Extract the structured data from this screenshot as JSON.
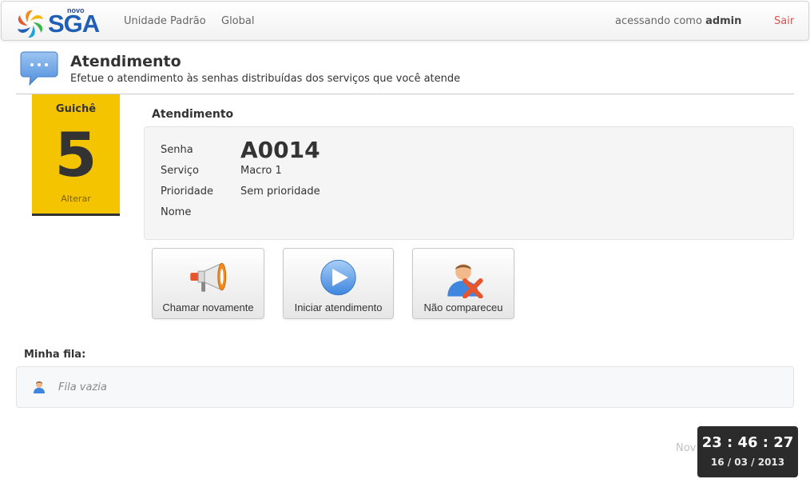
{
  "navbar": {
    "logo_small": "novo",
    "logo_text": "SGA",
    "links": [
      {
        "label": "Unidade Padrão"
      },
      {
        "label": "Global"
      }
    ],
    "user_prefix": "acessando como",
    "user_name": "admin",
    "logout_label": "Sair"
  },
  "header": {
    "title": "Atendimento",
    "subtitle": "Efetue o atendimento às senhas distribuídas dos serviços que você atende"
  },
  "guiche": {
    "label": "Guichê",
    "number": "5",
    "change_label": "Alterar"
  },
  "atendimento": {
    "title": "Atendimento",
    "fields": {
      "senha_label": "Senha",
      "senha_value": "A0014",
      "servico_label": "Serviço",
      "servico_value": "Macro 1",
      "prioridade_label": "Prioridade",
      "prioridade_value": "Sem prioridade",
      "nome_label": "Nome",
      "nome_value": ""
    }
  },
  "actions": {
    "call_again": "Chamar novamente",
    "start": "Iniciar atendimento",
    "no_show": "Não compareceu"
  },
  "fila": {
    "title": "Minha fila:",
    "empty_text": "Fila vazia"
  },
  "footer": {
    "text": "Nov"
  },
  "clock": {
    "time": "23 : 46 : 27",
    "date": "16 / 03 / 2013"
  },
  "colors": {
    "guiche_bg": "#f5c400",
    "logout": "#d9534f",
    "brand": "#1f5fb5",
    "clock_bg": "#2b2b2b"
  }
}
